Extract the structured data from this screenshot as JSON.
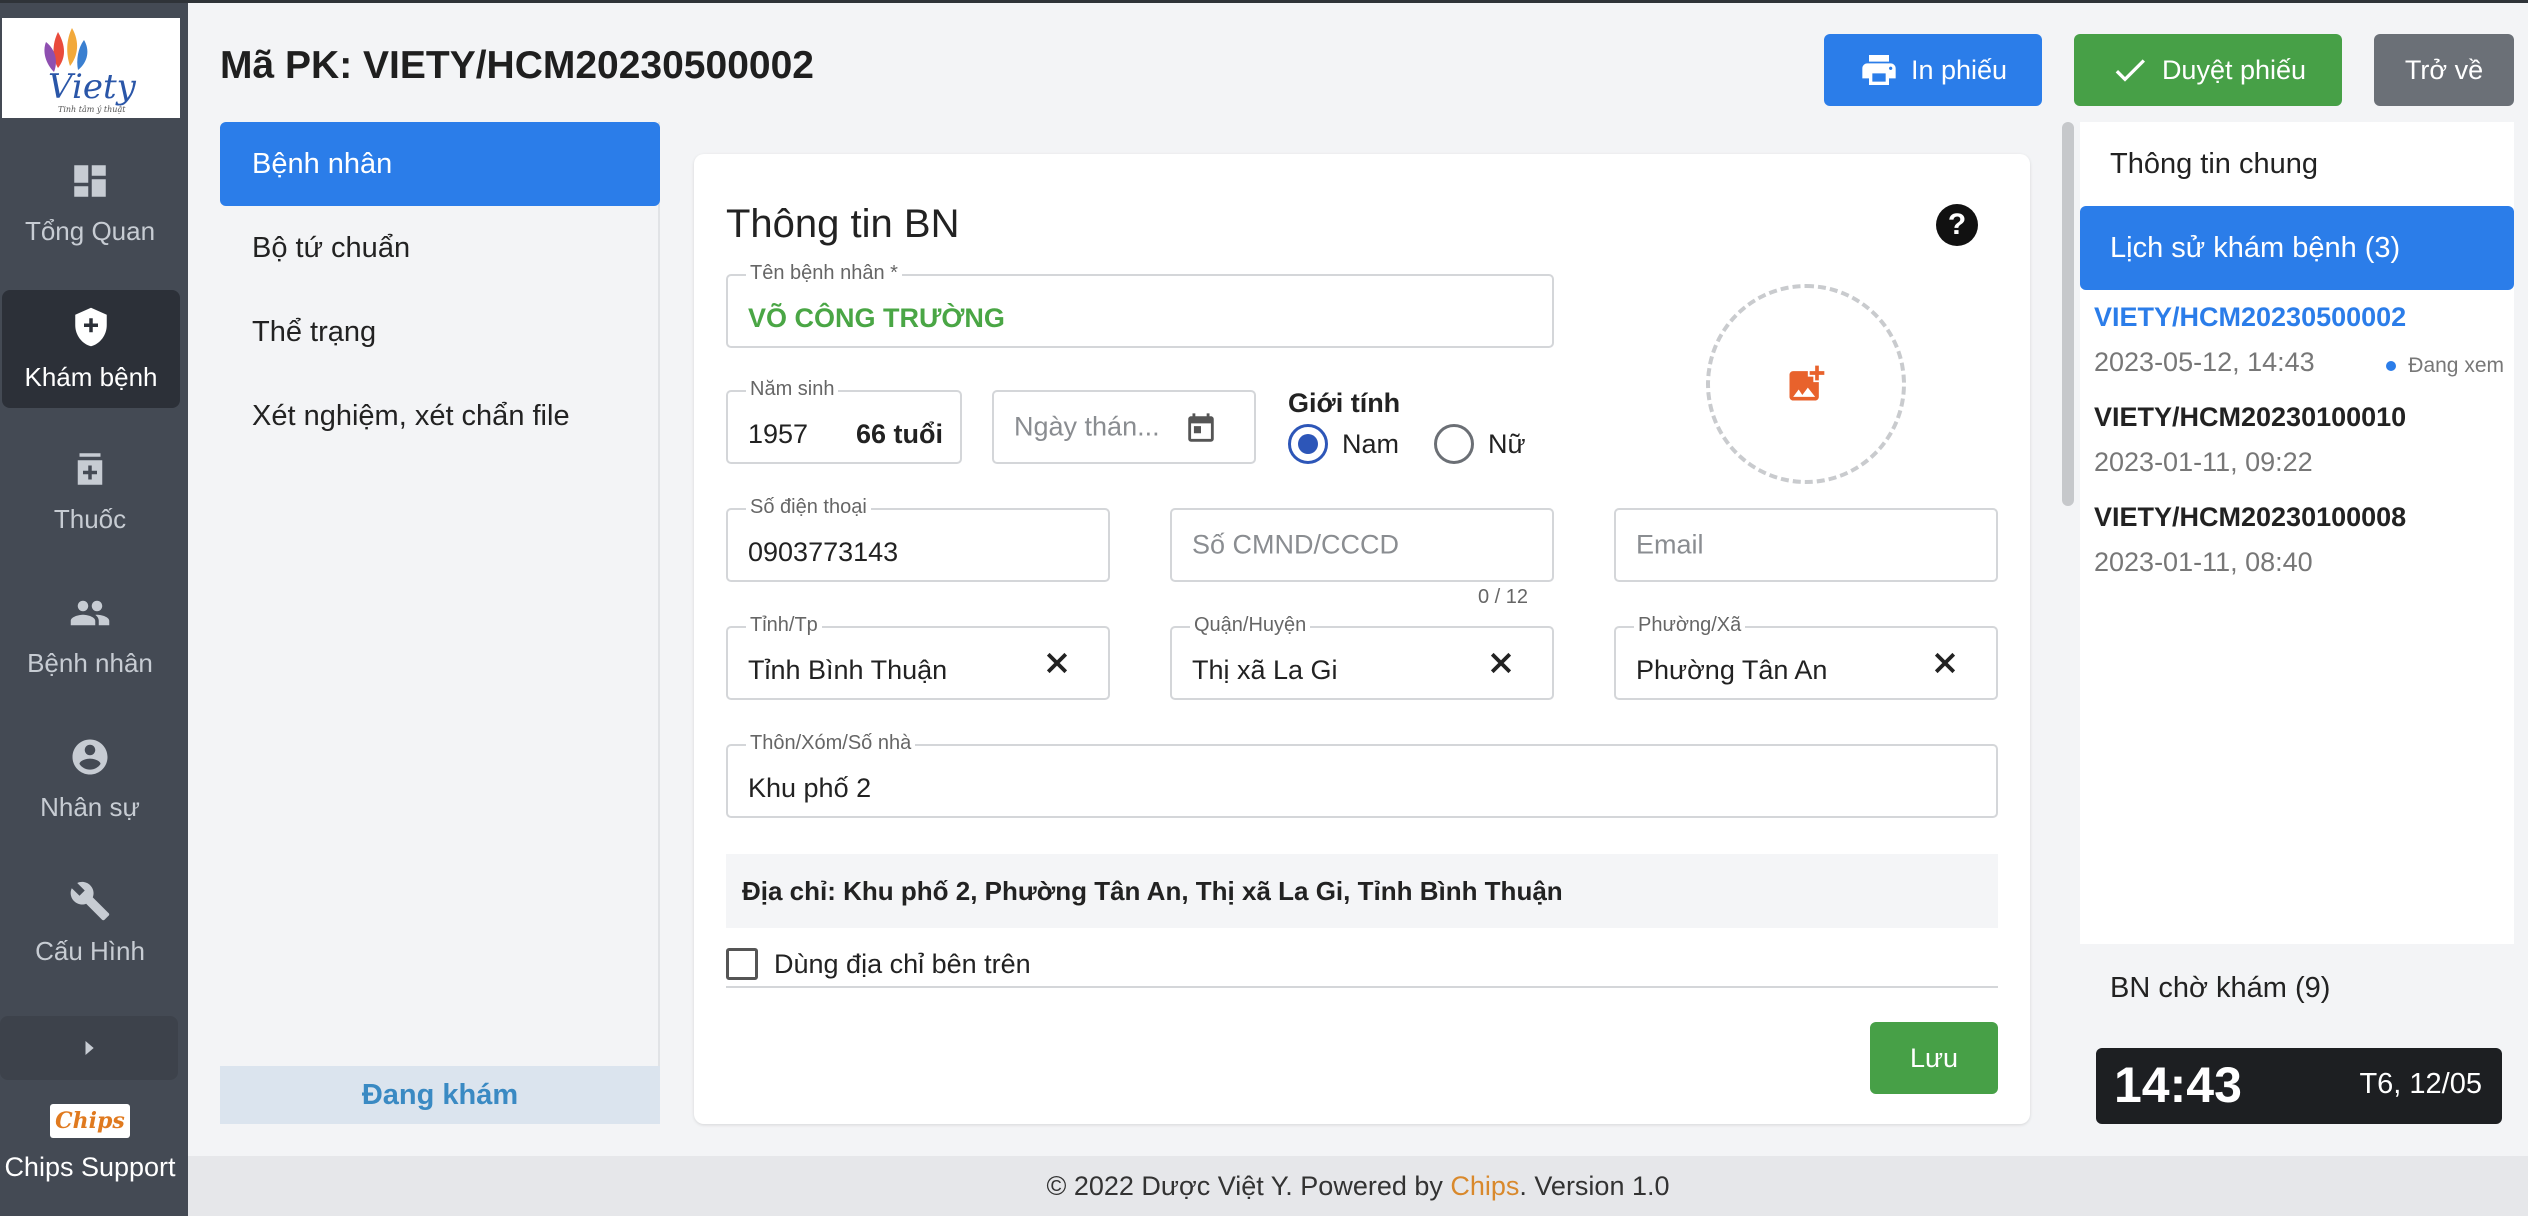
{
  "app": {
    "logo_alt": "Viety",
    "logo_text": "Viety",
    "logo_tagline": "Tinh tâm ý thuật"
  },
  "sidebar": {
    "items": [
      {
        "label": "Tổng Quan",
        "icon": "dashboard-icon"
      },
      {
        "label": "Khám bệnh",
        "icon": "shield-plus-icon",
        "active": true
      },
      {
        "label": "Thuốc",
        "icon": "medicine-icon"
      },
      {
        "label": "Bệnh nhân",
        "icon": "people-icon"
      },
      {
        "label": "Nhân sự",
        "icon": "account-circle-icon"
      },
      {
        "label": "Cấu Hình",
        "icon": "wrench-icon"
      }
    ],
    "chips_logo": "Chips",
    "chips_label": "Chips Support"
  },
  "header": {
    "title": "Mã PK: VIETY/HCM20230500002",
    "print_label": "In phiếu",
    "approve_label": "Duyệt phiếu",
    "back_label": "Trở về"
  },
  "submenu": {
    "items": [
      "Bệnh nhân",
      "Bộ tứ chuẩn",
      "Thể trạng",
      "Xét nghiệm, xét chẩn file"
    ],
    "active_index": 0,
    "status": "Đang khám"
  },
  "form": {
    "title": "Thông tin BN",
    "name": {
      "label": "Tên bệnh nhân *",
      "value": "VÕ CÔNG TRƯỜNG"
    },
    "birth_year": {
      "label": "Năm sinh",
      "value": "1957",
      "age": "66 tuổi"
    },
    "birth_date": {
      "placeholder": "Ngày thán..."
    },
    "gender": {
      "label": "Giới tính",
      "options": [
        "Nam",
        "Nữ"
      ],
      "selected": "Nam"
    },
    "phone": {
      "label": "Số điện thoại",
      "value": "0903773143"
    },
    "id_card": {
      "placeholder": "Số CMND/CCCD",
      "counter": "0 / 12"
    },
    "email": {
      "placeholder": "Email"
    },
    "province": {
      "label": "Tỉnh/Tp",
      "value": "Tỉnh Bình Thuận"
    },
    "district": {
      "label": "Quận/Huyện",
      "value": "Thị xã La Gi"
    },
    "ward": {
      "label": "Phường/Xã",
      "value": "Phường Tân An"
    },
    "street": {
      "label": "Thôn/Xóm/Số nhà",
      "value": "Khu phố 2"
    },
    "full_address": "Địa chỉ: Khu phố 2, Phường Tân An, Thị xã La Gi, Tỉnh Bình Thuận",
    "use_address_label": "Dùng địa chỉ bên trên",
    "save_label": "Lưu"
  },
  "right_panel": {
    "tabs": [
      "Thông tin chung",
      "Lịch sử khám bệnh (3)"
    ],
    "active_tab": 1,
    "history": [
      {
        "code": "VIETY/HCM20230500002",
        "time": "2023-05-12, 14:43",
        "status": "Đang xem",
        "current": true
      },
      {
        "code": "VIETY/HCM20230100010",
        "time": "2023-01-11, 09:22"
      },
      {
        "code": "VIETY/HCM20230100008",
        "time": "2023-01-11, 08:40"
      }
    ],
    "waiting_title": "BN chờ khám (9)",
    "clock_time": "14:43",
    "clock_date": "T6, 12/05"
  },
  "footer": {
    "prefix": "© 2022 Dược Việt Y. Powered by ",
    "brand": "Chips",
    "suffix": ". Version 1.0"
  },
  "colors": {
    "primary": "#2b7de9",
    "success": "#47a047",
    "sidebar": "#444a54",
    "brand_orange": "#d9892c"
  }
}
